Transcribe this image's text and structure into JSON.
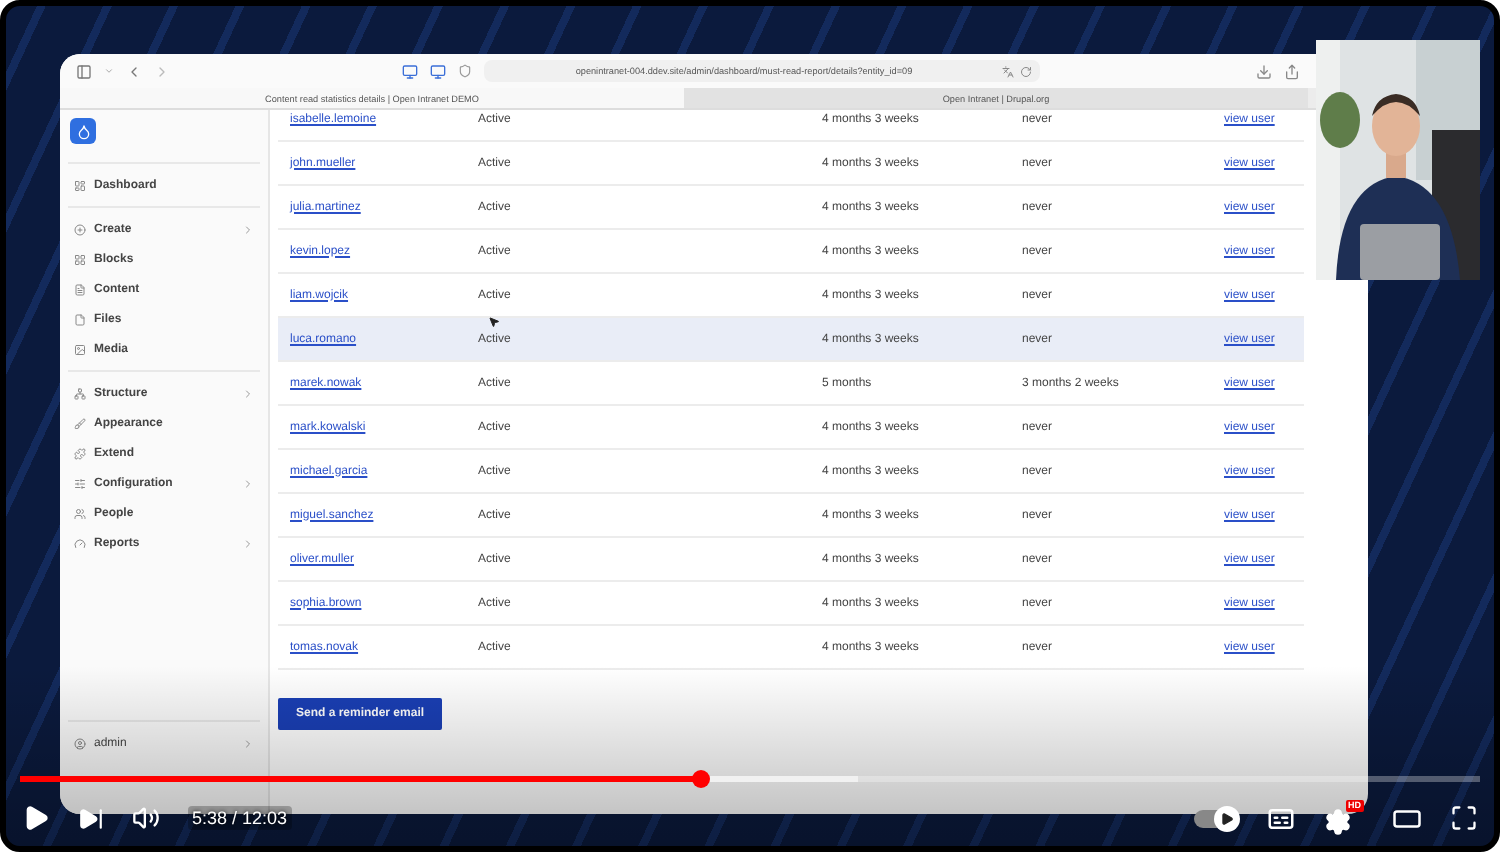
{
  "browser": {
    "url": "openintranet-004.ddev.site/admin/dashboard/must-read-report/details?entity_id=09",
    "tabs": [
      {
        "label": "Content read statistics details | Open Intranet DEMO",
        "selected": true
      },
      {
        "label": "Open Intranet | Drupal.org",
        "selected": false
      }
    ]
  },
  "sidebar": {
    "sections": [
      [
        {
          "label": "Dashboard",
          "has_submenu": false
        }
      ],
      [
        {
          "label": "Create",
          "has_submenu": true
        },
        {
          "label": "Blocks",
          "has_submenu": false
        },
        {
          "label": "Content",
          "has_submenu": false
        },
        {
          "label": "Files",
          "has_submenu": false
        },
        {
          "label": "Media",
          "has_submenu": false
        }
      ],
      [
        {
          "label": "Structure",
          "has_submenu": true
        },
        {
          "label": "Appearance",
          "has_submenu": false
        },
        {
          "label": "Extend",
          "has_submenu": false
        },
        {
          "label": "Configuration",
          "has_submenu": true
        },
        {
          "label": "People",
          "has_submenu": false
        },
        {
          "label": "Reports",
          "has_submenu": true
        }
      ]
    ],
    "user": {
      "label": "admin",
      "has_submenu": true
    }
  },
  "table": {
    "rows": [
      {
        "user": "isabelle.lemoine",
        "status": "Active",
        "column_3": "4 months 3 weeks",
        "column_4": "never",
        "link": "view user",
        "highlighted": false
      },
      {
        "user": "john.mueller",
        "status": "Active",
        "column_3": "4 months 3 weeks",
        "column_4": "never",
        "link": "view user",
        "highlighted": false
      },
      {
        "user": "julia.martinez",
        "status": "Active",
        "column_3": "4 months 3 weeks",
        "column_4": "never",
        "link": "view user",
        "highlighted": false
      },
      {
        "user": "kevin.lopez",
        "status": "Active",
        "column_3": "4 months 3 weeks",
        "column_4": "never",
        "link": "view user",
        "highlighted": false
      },
      {
        "user": "liam.wojcik",
        "status": "Active",
        "column_3": "4 months 3 weeks",
        "column_4": "never",
        "link": "view user",
        "highlighted": false
      },
      {
        "user": "luca.romano",
        "status": "Active",
        "column_3": "4 months 3 weeks",
        "column_4": "never",
        "link": "view user",
        "highlighted": true
      },
      {
        "user": "marek.nowak",
        "status": "Active",
        "column_3": "5 months",
        "column_4": "3 months 2 weeks",
        "link": "view user",
        "highlighted": false
      },
      {
        "user": "mark.kowalski",
        "status": "Active",
        "column_3": "4 months 3 weeks",
        "column_4": "never",
        "link": "view user",
        "highlighted": false
      },
      {
        "user": "michael.garcia",
        "status": "Active",
        "column_3": "4 months 3 weeks",
        "column_4": "never",
        "link": "view user",
        "highlighted": false
      },
      {
        "user": "miguel.sanchez",
        "status": "Active",
        "column_3": "4 months 3 weeks",
        "column_4": "never",
        "link": "view user",
        "highlighted": false
      },
      {
        "user": "oliver.muller",
        "status": "Active",
        "column_3": "4 months 3 weeks",
        "column_4": "never",
        "link": "view user",
        "highlighted": false
      },
      {
        "user": "sophia.brown",
        "status": "Active",
        "column_3": "4 months 3 weeks",
        "column_4": "never",
        "link": "view user",
        "highlighted": false
      },
      {
        "user": "tomas.novak",
        "status": "Active",
        "column_3": "4 months 3 weeks",
        "column_4": "never",
        "link": "view user",
        "highlighted": false
      }
    ]
  },
  "reminder_button": "Send a reminder email",
  "player": {
    "progress": {
      "level": 0.466
    },
    "buffer": {
      "level": 0.574
    },
    "time": "5:38 / 12:03",
    "autoplay": {
      "on": false
    },
    "settings_badge": "HD"
  }
}
